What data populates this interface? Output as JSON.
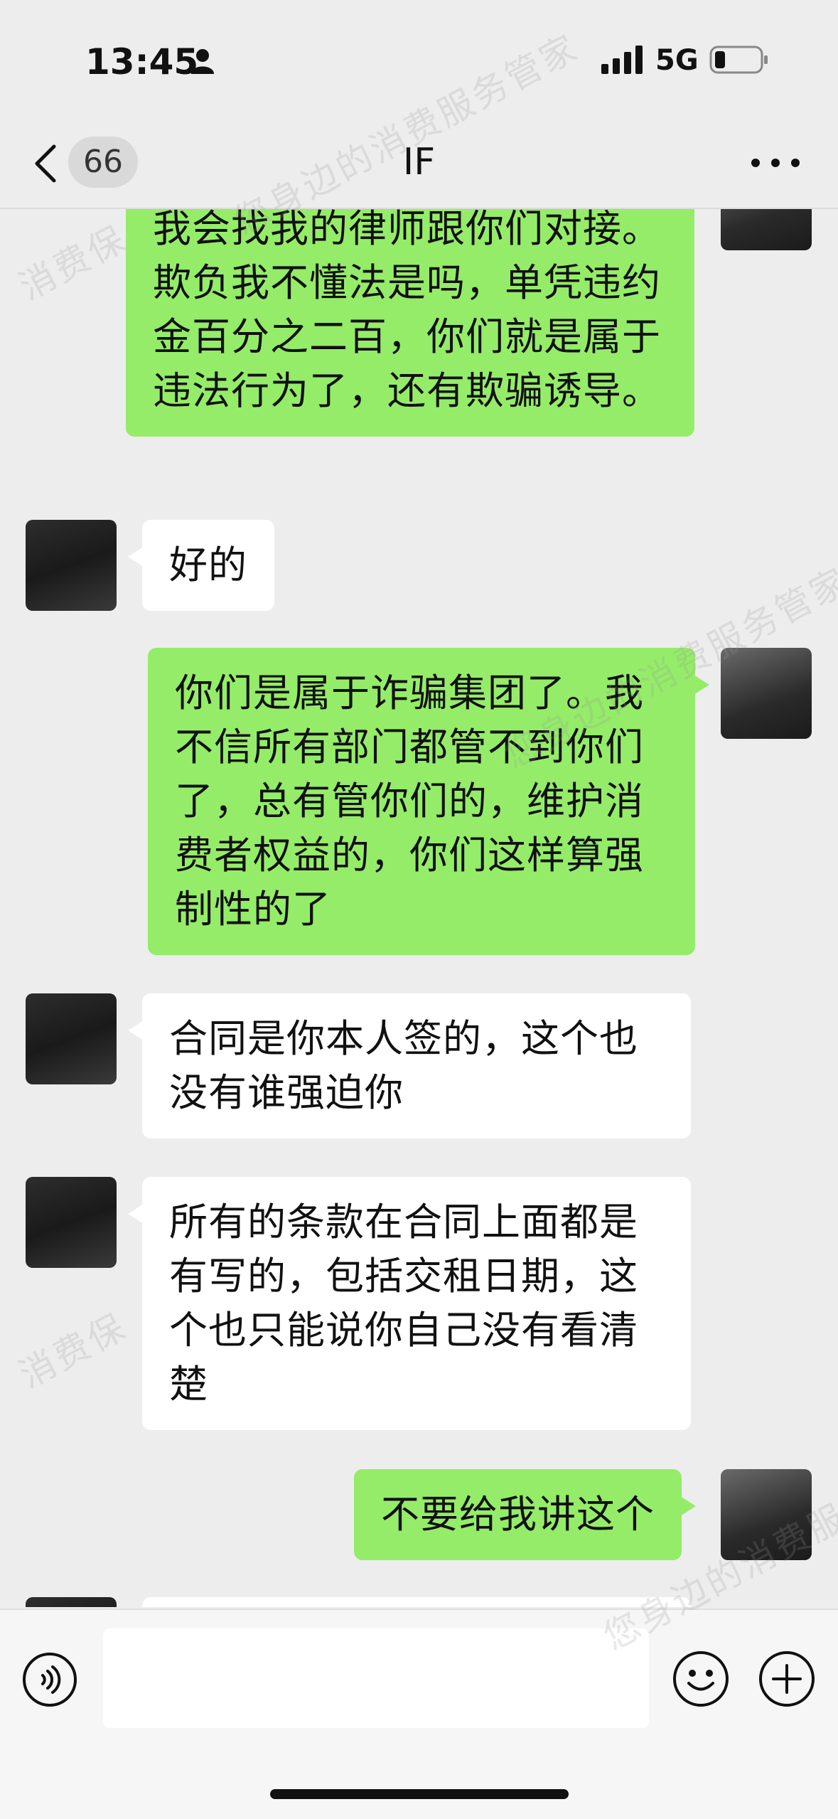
{
  "status_bar": {
    "time": "13:45",
    "network": "5G",
    "icons": [
      "person-icon",
      "signal-icon",
      "battery-icon"
    ]
  },
  "nav": {
    "back_icon": "chevron-left-icon",
    "unread_count": "66",
    "title": "IF",
    "more_icon": "more-icon"
  },
  "messages": [
    {
      "sender": "me",
      "text": "我会找我的律师跟你们对接。欺负我不懂法是吗，单凭违约金百分之二百，你们就是属于违法行为了，还有欺骗诱导。"
    },
    {
      "sender": "them",
      "text": "好的"
    },
    {
      "sender": "me",
      "text": "你们是属于诈骗集团了。我不信所有部门都管不到你们了，总有管你们的，维护消费者权益的，你们这样算强制性的了"
    },
    {
      "sender": "them",
      "text": "合同是你本人签的，这个也没有谁强迫你"
    },
    {
      "sender": "them",
      "text": "所有的条款在合同上面都是有写的，包括交租日期，这个也只能说你自己没有看清楚"
    },
    {
      "sender": "me",
      "text": "不要给我讲这个"
    }
  ],
  "input_bar": {
    "voice_icon": "voice-icon",
    "emoji_icon": "emoji-icon",
    "plus_icon": "plus-icon"
  },
  "watermark": {
    "text_a": "消费保",
    "text_b": "您身边的消费服务管家"
  },
  "colors": {
    "my_bubble": "#95ec69",
    "their_bubble": "#ffffff",
    "background": "#ededed"
  }
}
